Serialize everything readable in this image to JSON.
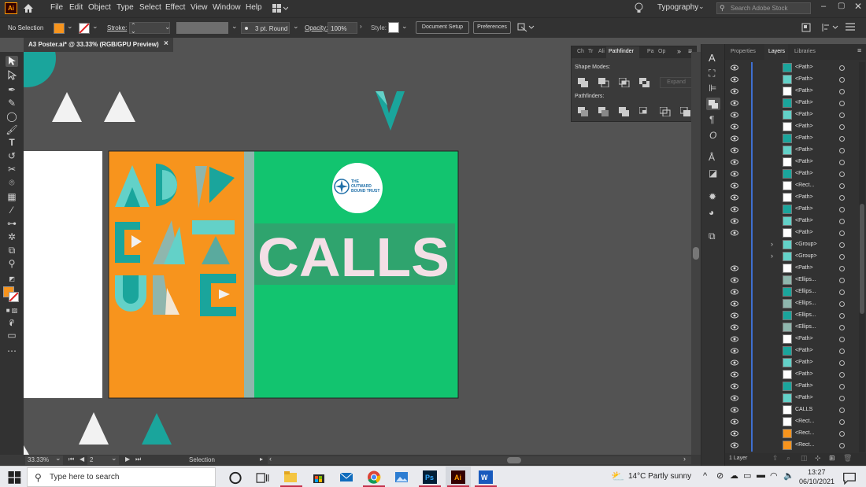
{
  "app": {
    "logo": "Ai",
    "menu": [
      "File",
      "Edit",
      "Object",
      "Type",
      "Select",
      "Effect",
      "View",
      "Window",
      "Help"
    ],
    "workspace": "Typography",
    "search_placeholder": "Search Adobe Stock"
  },
  "control_bar": {
    "selection_label": "No Selection",
    "stroke_label": "Stroke:",
    "stroke_profile": "3 pt. Round",
    "opacity_label": "Opacity:",
    "opacity_value": "100%",
    "style_label": "Style:",
    "document_setup": "Document Setup",
    "preferences": "Preferences"
  },
  "document_tab": {
    "title": "A3 Poster.ai* @ 33.33% (RGB/GPU Preview)",
    "close": "×"
  },
  "artwork": {
    "headline": "CALLS",
    "logo_text": [
      "THE",
      "OUTWARD",
      "BOUND TRUST"
    ],
    "colors": {
      "orange": "#f7941d",
      "green": "#12c46f",
      "teal": "#1aa59c",
      "light_teal": "#63d1c8",
      "grey_teal": "#8fb6ad",
      "pink_text": "#f3dfe6"
    }
  },
  "pathfinder": {
    "tabs": [
      "Ch",
      "Tr",
      "Ali",
      "Pathfinder",
      "Pa",
      "Op"
    ],
    "shape_modes_label": "Shape Modes:",
    "pathfinders_label": "Pathfinders:",
    "expand": "Expand"
  },
  "status": {
    "zoom": "33.33%",
    "artboard": "2",
    "tool": "Selection"
  },
  "panel": {
    "tabs": [
      "Properties",
      "Layers",
      "Libraries"
    ],
    "footer": "1 Layer",
    "layers": [
      {
        "name": "<Path>",
        "type": "path"
      },
      {
        "name": "<Path>",
        "type": "path"
      },
      {
        "name": "<Path>",
        "type": "path"
      },
      {
        "name": "<Path>",
        "type": "path"
      },
      {
        "name": "<Path>",
        "type": "path"
      },
      {
        "name": "<Path>",
        "type": "path"
      },
      {
        "name": "<Path>",
        "type": "path"
      },
      {
        "name": "<Path>",
        "type": "path"
      },
      {
        "name": "<Path>",
        "type": "path"
      },
      {
        "name": "<Path>",
        "type": "path"
      },
      {
        "name": "<Rect...",
        "type": "rect"
      },
      {
        "name": "<Path>",
        "type": "path"
      },
      {
        "name": "<Path>",
        "type": "path"
      },
      {
        "name": "<Path>",
        "type": "path"
      },
      {
        "name": "<Path>",
        "type": "path"
      },
      {
        "name": "<Group>",
        "type": "group"
      },
      {
        "name": "<Group>",
        "type": "group"
      },
      {
        "name": "<Path>",
        "type": "path"
      },
      {
        "name": "<Ellips...",
        "type": "ellipse"
      },
      {
        "name": "<Ellips...",
        "type": "ellipse"
      },
      {
        "name": "<Ellips...",
        "type": "ellipse"
      },
      {
        "name": "<Ellips...",
        "type": "ellipse"
      },
      {
        "name": "<Ellips...",
        "type": "ellipse"
      },
      {
        "name": "<Path>",
        "type": "path"
      },
      {
        "name": "<Path>",
        "type": "path"
      },
      {
        "name": "<Path>",
        "type": "path"
      },
      {
        "name": "<Path>",
        "type": "path"
      },
      {
        "name": "<Path>",
        "type": "path"
      },
      {
        "name": "<Path>",
        "type": "path"
      },
      {
        "name": "CALLS",
        "type": "text"
      },
      {
        "name": "<Rect...",
        "type": "rect"
      },
      {
        "name": "<Rect...",
        "type": "rect"
      },
      {
        "name": "<Rect...",
        "type": "rect"
      }
    ]
  },
  "taskbar": {
    "search_placeholder": "Type here to search",
    "weather": "14°C  Partly sunny",
    "time": "13:27",
    "date": "06/10/2021"
  }
}
